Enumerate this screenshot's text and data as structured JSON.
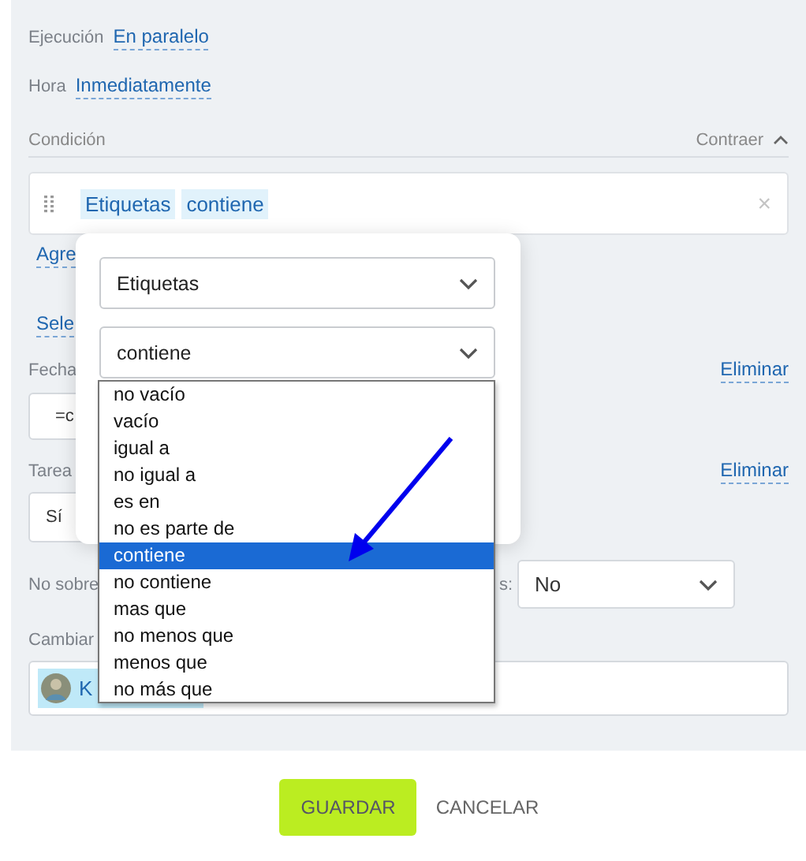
{
  "execution": {
    "label": "Ejecución",
    "value": "En paralelo"
  },
  "time": {
    "label": "Hora",
    "value": "Inmediatamente"
  },
  "condition": {
    "label": "Condición",
    "collapse_link": "Contraer",
    "chips": [
      "Etiquetas",
      "contiene"
    ],
    "remove_glyph": "×"
  },
  "add_link": "Agre",
  "select_link": "Sele",
  "date_field": {
    "label": "Fecha",
    "remove_link": "Eliminar",
    "value": "=c"
  },
  "task_field": {
    "label": "Tarea",
    "remove_link": "Eliminar",
    "value": "Sí"
  },
  "no_overlap": {
    "label": "No sobre",
    "label_end": "s:",
    "value": "No"
  },
  "change": {
    "label": "Cambiar",
    "chip": "K"
  },
  "buttons": [
    {
      "label": "GUARDAR",
      "kind": "primary"
    },
    {
      "label": "CANCELAR",
      "kind": "link"
    }
  ],
  "popup": {
    "field_select": "Etiquetas",
    "operator_select": "contiene",
    "options": [
      {
        "label": "no vacío",
        "selected": false
      },
      {
        "label": "vacío",
        "selected": false
      },
      {
        "label": "igual a",
        "selected": false
      },
      {
        "label": "no igual a",
        "selected": false
      },
      {
        "label": "es en",
        "selected": false
      },
      {
        "label": "no es parte de",
        "selected": false
      },
      {
        "label": "contiene",
        "selected": true
      },
      {
        "label": "no contiene",
        "selected": false
      },
      {
        "label": "mas que",
        "selected": false
      },
      {
        "label": "no menos que",
        "selected": false
      },
      {
        "label": "menos que",
        "selected": false
      },
      {
        "label": "no más que",
        "selected": false
      }
    ]
  }
}
